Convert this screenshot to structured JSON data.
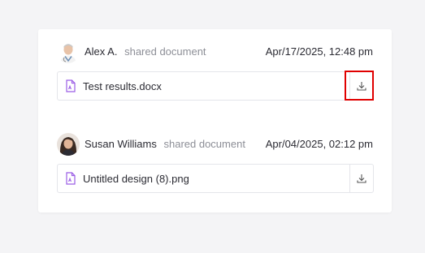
{
  "activity": [
    {
      "user": "Alex A.",
      "action": "shared document",
      "timestamp": "Apr/17/2025, 12:48 pm",
      "avatar_icon": "avatar-male-doctor",
      "file": {
        "name": "Test results.docx",
        "icon": "file-icon",
        "action_icon": "download-icon"
      }
    },
    {
      "user": "Susan Williams",
      "action": "shared document",
      "timestamp": "Apr/04/2025, 02:12 pm",
      "avatar_icon": "avatar-female",
      "file": {
        "name": "Untitled design (8).png",
        "icon": "file-icon",
        "action_icon": "download-icon"
      }
    }
  ],
  "colors": {
    "accent_file_icon": "#9b5de5",
    "highlight": "#e00000",
    "text_primary": "#2b2b33",
    "text_secondary": "#8d8f97"
  }
}
